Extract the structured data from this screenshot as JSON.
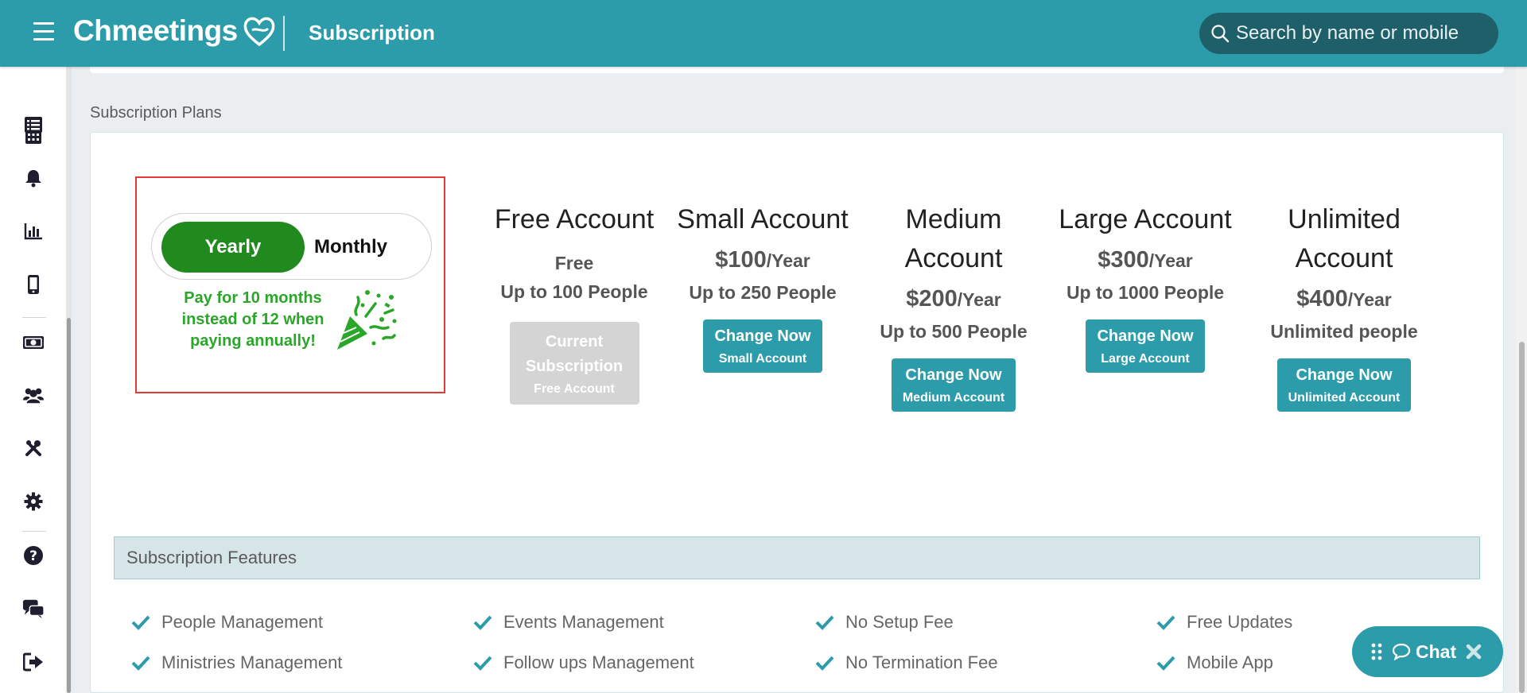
{
  "header": {
    "logo_text": "Chmeetings",
    "page_title": "Subscription",
    "search_placeholder": "Search by name or mobile"
  },
  "sidebar": {
    "icons": [
      "calendar-icon",
      "list-icon",
      "bell-icon",
      "bar-chart-icon",
      "mobile-icon",
      "money-icon",
      "users-icon",
      "tools-icon",
      "gear-icon",
      "help-icon",
      "chat-bubbles-icon",
      "logout-icon"
    ]
  },
  "section_label": "Subscription Plans",
  "billing_toggle": {
    "yearly_label": "Yearly",
    "monthly_label": "Monthly",
    "selected": "Yearly",
    "promo_text": "Pay for 10 months instead of 12 when paying annually!"
  },
  "plans": [
    {
      "name": "Free Account",
      "price": "Free",
      "per": "",
      "people": "Up to 100 People",
      "button_line1": "Current Subscription",
      "button_line2": "Free Account",
      "current": true
    },
    {
      "name": "Small Account",
      "price": "$100",
      "per": "/Year",
      "people": "Up to 250 People",
      "button_line1": "Change Now",
      "button_line2": "Small Account",
      "current": false
    },
    {
      "name": "Medium Account",
      "price": "$200",
      "per": "/Year",
      "people": "Up to 500 People",
      "button_line1": "Change Now",
      "button_line2": "Medium Account",
      "current": false
    },
    {
      "name": "Large Account",
      "price": "$300",
      "per": "/Year",
      "people": "Up to 1000 People",
      "button_line1": "Change Now",
      "button_line2": "Large Account",
      "current": false
    },
    {
      "name": "Unlimited Account",
      "price": "$400",
      "per": "/Year",
      "people": "Unlimited people",
      "button_line1": "Change Now",
      "button_line2": "Unlimited Account",
      "current": false
    }
  ],
  "features": {
    "title": "Subscription Features",
    "items": [
      "People Management",
      "Events Management",
      "No Setup Fee",
      "Free Updates",
      "Ministries Management",
      "Follow ups Management",
      "No Termination Fee",
      "Mobile App"
    ]
  },
  "chat": {
    "label": "Chat"
  },
  "colors": {
    "primary": "#2d9caa",
    "toggle_active": "#218a1f",
    "promo": "#2aa628",
    "highlight_border": "#e53935"
  }
}
